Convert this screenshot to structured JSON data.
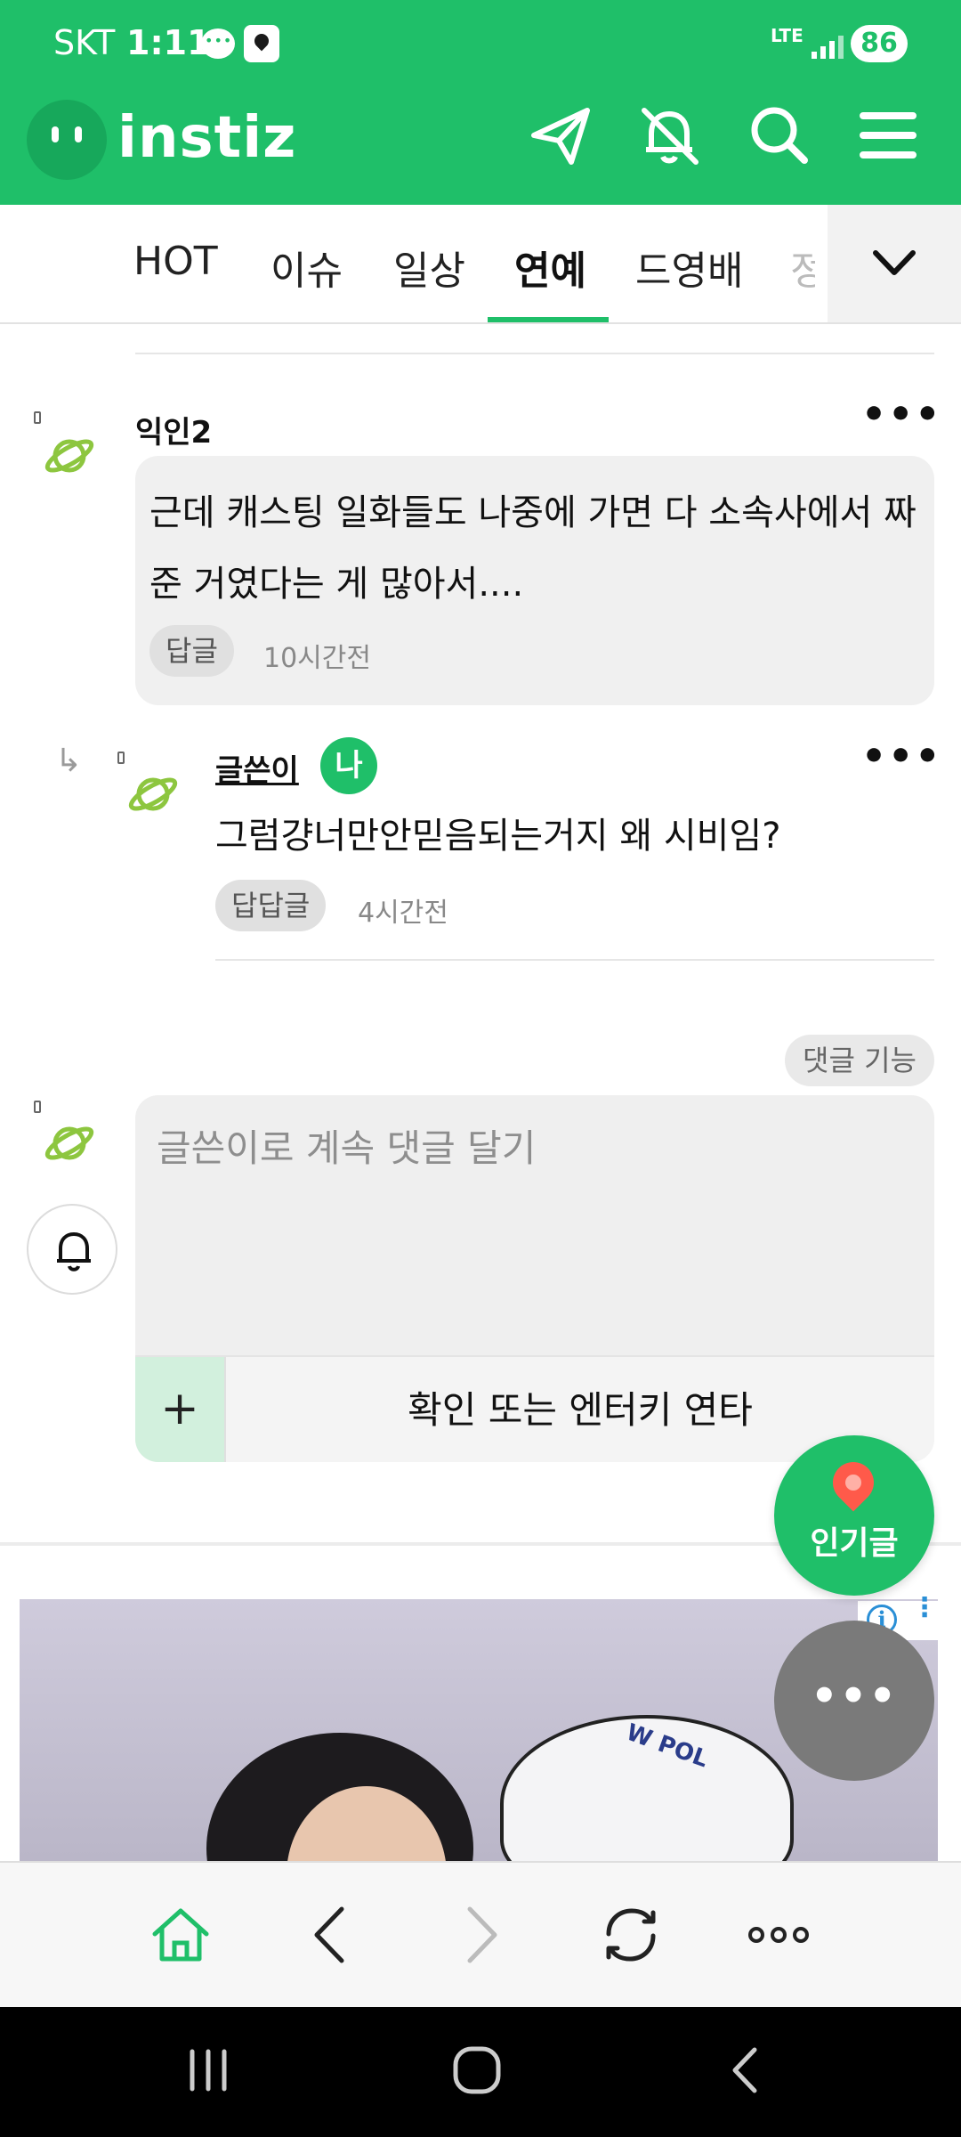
{
  "status_bar": {
    "carrier": "SKT",
    "time": "1:11",
    "network": "LTE",
    "battery": "86"
  },
  "header": {
    "logo_text": "instiz"
  },
  "tabs": [
    {
      "label": "HOT",
      "active": false
    },
    {
      "label": "이슈",
      "active": false
    },
    {
      "label": "일상",
      "active": false
    },
    {
      "label": "연예",
      "active": true
    },
    {
      "label": "드영배",
      "active": false
    },
    {
      "label": "정",
      "active": false
    }
  ],
  "comments": {
    "first": {
      "nickname": "익인2",
      "text": "근데 캐스팅 일화들도 나중에 가면 다 소속사에서 짜 준 거였다는 게 많아서....",
      "reply_label": "답글",
      "time": "10시간전"
    },
    "reply": {
      "nickname": "글쓴이",
      "badge": "나",
      "text": "그럼걍너만안믿음되는거지 왜 시비임?",
      "reply_label": "답답글",
      "time": "4시간전"
    }
  },
  "compose": {
    "feature_button": "댓글 기능",
    "placeholder": "글쓴이로 계속 댓글 달기",
    "plus": "+",
    "submit": "확인 또는 엔터키 연타"
  },
  "fab": {
    "hot_label": "인기글",
    "more_label": "•••"
  },
  "colors": {
    "brand_green": "#1fbf69",
    "planet_green": "#8dc63f"
  }
}
